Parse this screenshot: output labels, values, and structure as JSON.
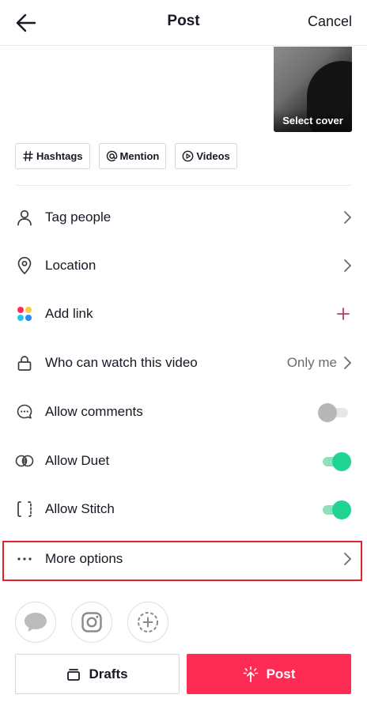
{
  "header": {
    "title": "Post",
    "cancel_label": "Cancel",
    "back_icon": "arrow-left-icon"
  },
  "cover": {
    "label": "Select cover"
  },
  "chips": [
    {
      "label": "Hashtags",
      "icon": "hashtag-icon"
    },
    {
      "label": "Mention",
      "icon": "at-icon"
    },
    {
      "label": "Videos",
      "icon": "play-circle-icon"
    }
  ],
  "settings": {
    "tag_people": "Tag people",
    "location": "Location",
    "add_link": "Add link",
    "who_can_watch": "Who can watch this video",
    "who_can_watch_value": "Only me",
    "allow_comments": "Allow comments",
    "allow_comments_on": false,
    "allow_duet": "Allow Duet",
    "allow_duet_on": true,
    "allow_stitch": "Allow Stitch",
    "allow_stitch_on": true,
    "more_options": "More options"
  },
  "share_targets": [
    "chat-bubble-icon",
    "instagram-icon",
    "add-circle-icon"
  ],
  "actions": {
    "drafts_label": "Drafts",
    "post_label": "Post"
  },
  "colors": {
    "accent": "#fe2c55",
    "toggle_on": "#1fd490",
    "highlight_border": "#e1222d",
    "link_plus": "#c0395a"
  }
}
